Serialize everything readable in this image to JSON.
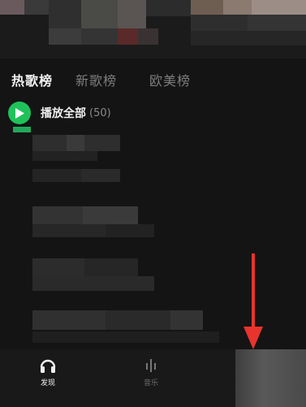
{
  "tabs": [
    {
      "label": "热歌榜",
      "active": true
    },
    {
      "label": "新歌榜",
      "active": false
    },
    {
      "label": "欧美榜",
      "active": false
    }
  ],
  "play_all": {
    "label": "播放全部",
    "count": "(50)"
  },
  "bottom_nav": [
    {
      "label": "发现",
      "icon": "headphones-icon",
      "active": true
    },
    {
      "label": "音乐",
      "icon": "equalizer-icon",
      "active": false
    }
  ],
  "colors": {
    "background": "#141414",
    "accent_green": "#1fc25a",
    "annotation_arrow": "#e8342c"
  }
}
